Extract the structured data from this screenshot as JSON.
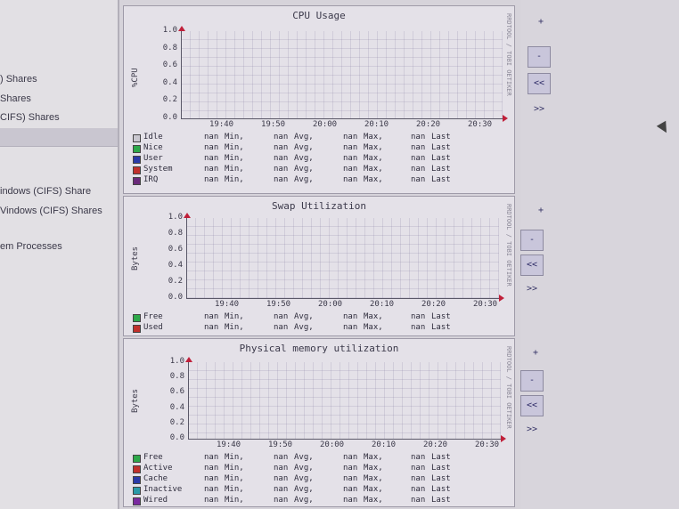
{
  "sidebar": {
    "items": [
      {
        "label": ") Shares"
      },
      {
        "label": "Shares"
      },
      {
        "label": "CIFS) Shares"
      },
      {
        "label": "indows (CIFS) Share"
      },
      {
        "label": "Vindows (CIFS) Shares"
      },
      {
        "label": "em Processes"
      }
    ]
  },
  "graphs": [
    {
      "title": "CPU Usage",
      "ylabel": "%CPU",
      "side_label": "RRDTOOL / TOBI OETIKER",
      "yticks": [
        "1.0",
        "0.8",
        "0.6",
        "0.4",
        "0.2",
        "0.0"
      ],
      "xticks": [
        "19:40",
        "19:50",
        "20:00",
        "20:10",
        "20:20",
        "20:30"
      ],
      "legend": [
        {
          "name": "Idle",
          "color": "#c9c7cf",
          "v1": "nan",
          "l1": "Min,",
          "v2": "nan",
          "l2": "Avg,",
          "v3": "nan",
          "l3": "Max,",
          "v4": "nan",
          "l4": "Last"
        },
        {
          "name": "Nice",
          "color": "#2ea84a",
          "v1": "nan",
          "l1": "Min,",
          "v2": "nan",
          "l2": "Avg,",
          "v3": "nan",
          "l3": "Max,",
          "v4": "nan",
          "l4": "Last"
        },
        {
          "name": "User",
          "color": "#2a3aa8",
          "v1": "nan",
          "l1": "Min,",
          "v2": "nan",
          "l2": "Avg,",
          "v3": "nan",
          "l3": "Max,",
          "v4": "nan",
          "l4": "Last"
        },
        {
          "name": "System",
          "color": "#c0302c",
          "v1": "nan",
          "l1": "Min,",
          "v2": "nan",
          "l2": "Avg,",
          "v3": "nan",
          "l3": "Max,",
          "v4": "nan",
          "l4": "Last"
        },
        {
          "name": "IRQ",
          "color": "#6a2a7a",
          "v1": "nan",
          "l1": "Min,",
          "v2": "nan",
          "l2": "Avg,",
          "v3": "nan",
          "l3": "Max,",
          "v4": "nan",
          "l4": "Last"
        }
      ]
    },
    {
      "title": "Swap Utilization",
      "ylabel": "Bytes",
      "side_label": "RRDTOOL / TOBI OETIKER",
      "yticks": [
        "1.0",
        "0.8",
        "0.6",
        "0.4",
        "0.2",
        "0.0"
      ],
      "xticks": [
        "19:40",
        "19:50",
        "20:00",
        "20:10",
        "20:20",
        "20:30"
      ],
      "legend": [
        {
          "name": "Free",
          "color": "#2ea84a",
          "v1": "nan",
          "l1": "Min,",
          "v2": "nan",
          "l2": "Avg,",
          "v3": "nan",
          "l3": "Max,",
          "v4": "nan",
          "l4": "Last"
        },
        {
          "name": "Used",
          "color": "#c0302c",
          "v1": "nan",
          "l1": "Min,",
          "v2": "nan",
          "l2": "Avg,",
          "v3": "nan",
          "l3": "Max,",
          "v4": "nan",
          "l4": "Last"
        }
      ]
    },
    {
      "title": "Physical memory utilization",
      "ylabel": "Bytes",
      "side_label": "RRDTOOL / TOBI OETIKER",
      "yticks": [
        "1.0",
        "0.8",
        "0.6",
        "0.4",
        "0.2",
        "0.0"
      ],
      "xticks": [
        "19:40",
        "19:50",
        "20:00",
        "20:10",
        "20:20",
        "20:30"
      ],
      "legend": [
        {
          "name": "Free",
          "color": "#2ea84a",
          "v1": "nan",
          "l1": "Min,",
          "v2": "nan",
          "l2": "Avg,",
          "v3": "nan",
          "l3": "Max,",
          "v4": "nan",
          "l4": "Last"
        },
        {
          "name": "Active",
          "color": "#c0302c",
          "v1": "nan",
          "l1": "Min,",
          "v2": "nan",
          "l2": "Avg,",
          "v3": "nan",
          "l3": "Max,",
          "v4": "nan",
          "l4": "Last"
        },
        {
          "name": "Cache",
          "color": "#2a3aa8",
          "v1": "nan",
          "l1": "Min,",
          "v2": "nan",
          "l2": "Avg,",
          "v3": "nan",
          "l3": "Max,",
          "v4": "nan",
          "l4": "Last"
        },
        {
          "name": "Inactive",
          "color": "#2a9aa8",
          "v1": "nan",
          "l1": "Min,",
          "v2": "nan",
          "l2": "Avg,",
          "v3": "nan",
          "l3": "Max,",
          "v4": "nan",
          "l4": "Last"
        },
        {
          "name": "Wired",
          "color": "#7a2aa0",
          "v1": "nan",
          "l1": "Min,",
          "v2": "nan",
          "l2": "Avg,",
          "v3": "nan",
          "l3": "Max,",
          "v4": "nan",
          "l4": "Last"
        }
      ]
    }
  ],
  "controls": {
    "zoom_in": "+",
    "zoom_out": "-",
    "back": "<<",
    "forward": ">>"
  }
}
